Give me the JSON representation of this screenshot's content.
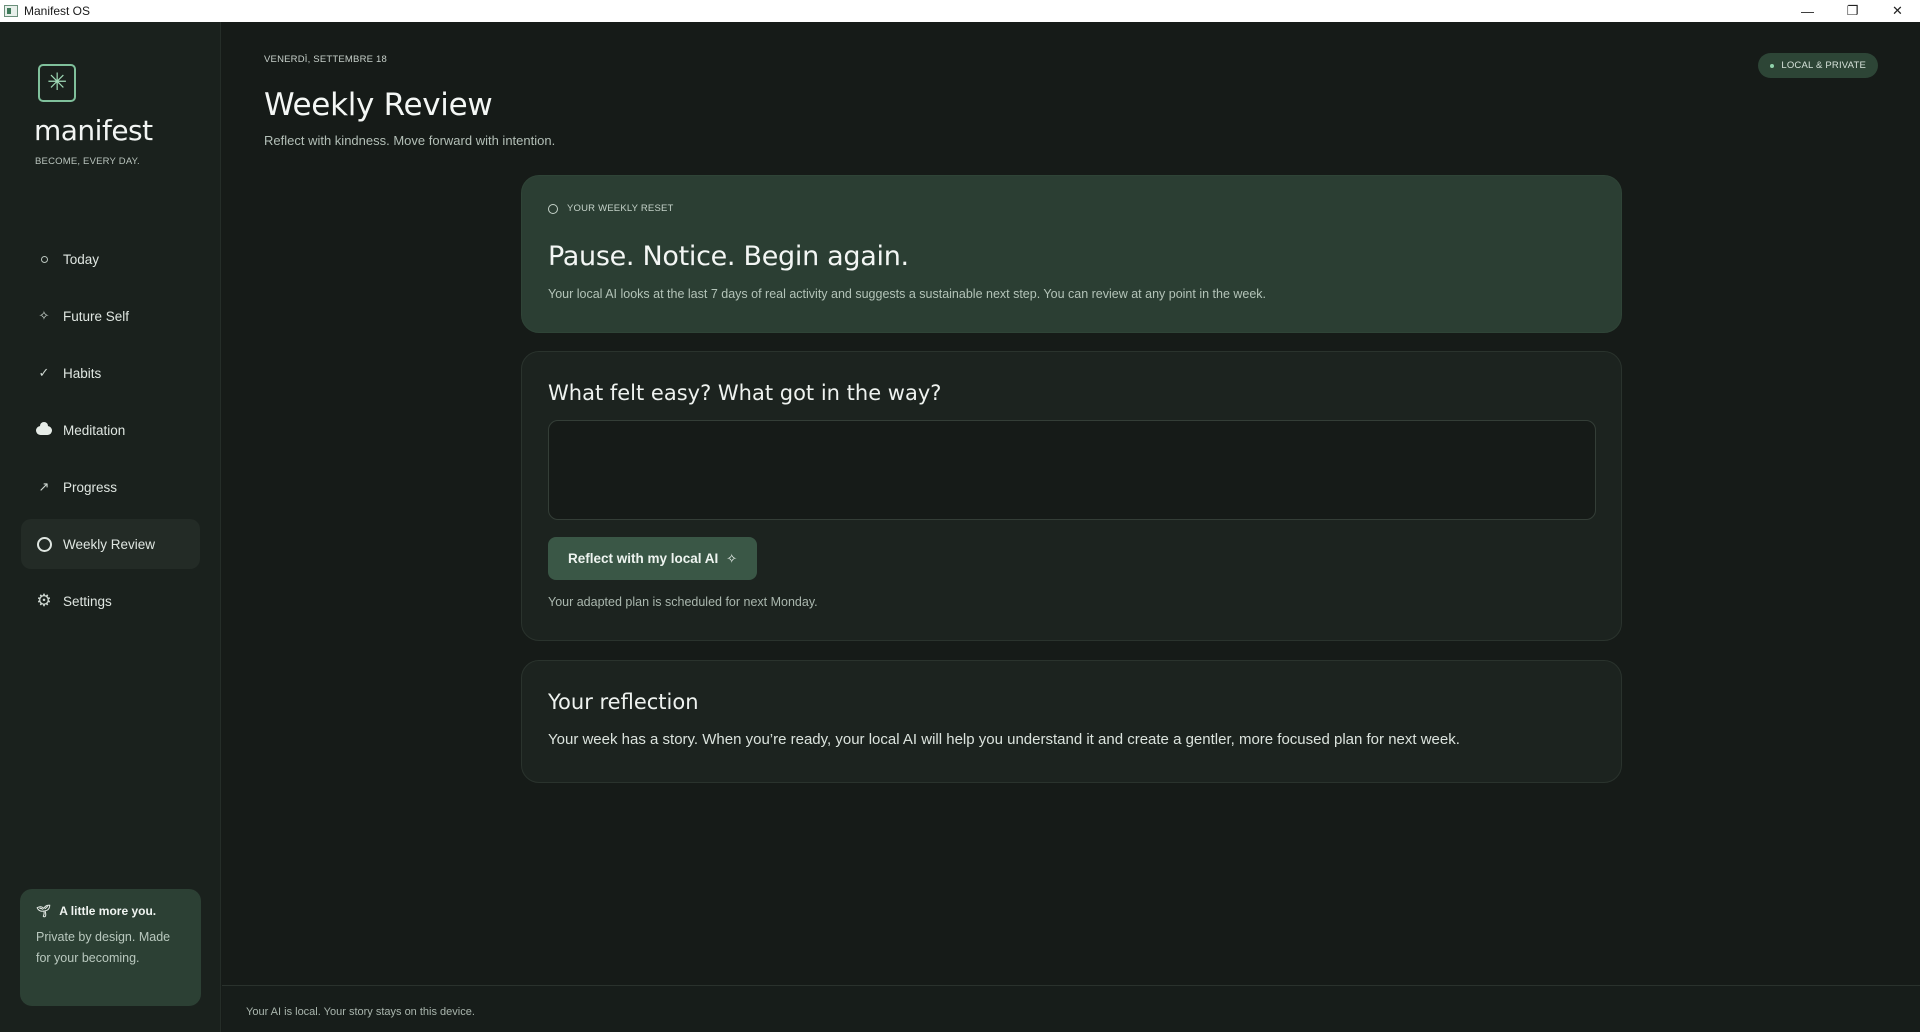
{
  "window": {
    "title": "Manifest OS",
    "controls": {
      "minimize": "—",
      "maximize": "❐",
      "close": "✕"
    }
  },
  "sidebar": {
    "logo_icon": "asterisk-logo-icon",
    "brand": "manifest",
    "tagline": "BECOME, EVERY DAY.",
    "items": [
      {
        "label": "Today",
        "icon": "circle-dot-icon",
        "active": false
      },
      {
        "label": "Future Self",
        "icon": "sparkle-icon",
        "active": false
      },
      {
        "label": "Habits",
        "icon": "check-icon",
        "active": false
      },
      {
        "label": "Meditation",
        "icon": "cloud-icon",
        "active": false
      },
      {
        "label": "Progress",
        "icon": "arrow-up-right-icon",
        "active": false
      },
      {
        "label": "Weekly Review",
        "icon": "ring-icon",
        "active": true
      },
      {
        "label": "Settings",
        "icon": "gear-icon",
        "active": false
      }
    ],
    "promo": {
      "icon": "sprout-icon",
      "title": "A little more you.",
      "body": "Private by design. Made for your becoming."
    }
  },
  "header": {
    "date": "VENERDÌ, SETTEMBRE 18",
    "title": "Weekly Review",
    "subtitle": "Reflect with kindness. Move forward with intention.",
    "badge": "LOCAL & PRIVATE"
  },
  "hero": {
    "eyebrow": "YOUR WEEKLY RESET",
    "title": "Pause. Notice. Begin again.",
    "description": "Your local AI looks at the last 7 days of real activity and suggests a sustainable next step. You can review at any point in the week."
  },
  "prompt_card": {
    "question": "What felt easy? What got in the way?",
    "input_value": "",
    "input_placeholder": "",
    "button_label": "Reflect with my local AI",
    "schedule_note": "Your adapted plan is scheduled for next Monday."
  },
  "reflection": {
    "title": "Your reflection",
    "body": "Your week has a story. When you’re ready, your local AI will help you understand it and create a gentler, more focused plan for next week."
  },
  "footer": {
    "text": "Your AI is local. Your story stays on this device."
  },
  "colors": {
    "background": "#161b18",
    "sidebar": "#1a211d",
    "accent": "#3a5746",
    "hero_card": "#2b3e33",
    "brand_green": "#7fc09b"
  }
}
